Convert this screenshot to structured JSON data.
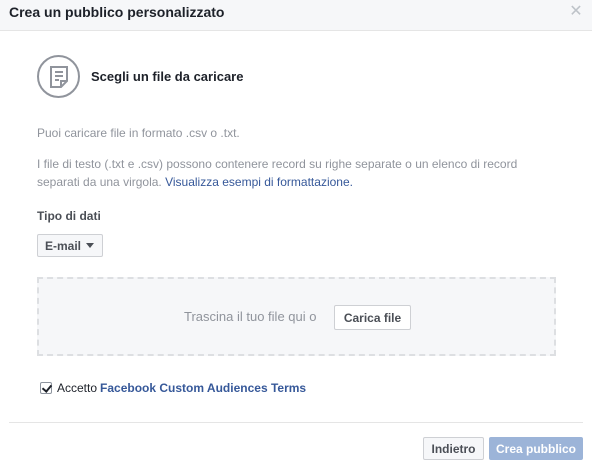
{
  "dialog": {
    "title": "Crea un pubblico personalizzato",
    "close_icon": "close-icon"
  },
  "section": {
    "icon": "file-icon",
    "title": "Scegli un file da caricare"
  },
  "info": {
    "line1": "Puoi caricare file in formato .csv o .txt.",
    "line2": "I file di testo (.txt e .csv) possono contenere record su righe separate o un elenco di record separati da una virgola. ",
    "link": "Visualizza esempi di formattazione."
  },
  "data_type": {
    "label": "Tipo di dati",
    "selected": "E-mail"
  },
  "dropzone": {
    "text": "Trascina il tuo file qui o",
    "upload_label": "Carica file"
  },
  "terms": {
    "checked": true,
    "prefix": "Accetto",
    "link": "Facebook Custom Audiences Terms"
  },
  "footer": {
    "back_label": "Indietro",
    "create_label": "Crea pubblico"
  },
  "colors": {
    "link": "#365899",
    "header_bg": "#f6f7f9",
    "disabled_primary": "#9cb4d8"
  }
}
